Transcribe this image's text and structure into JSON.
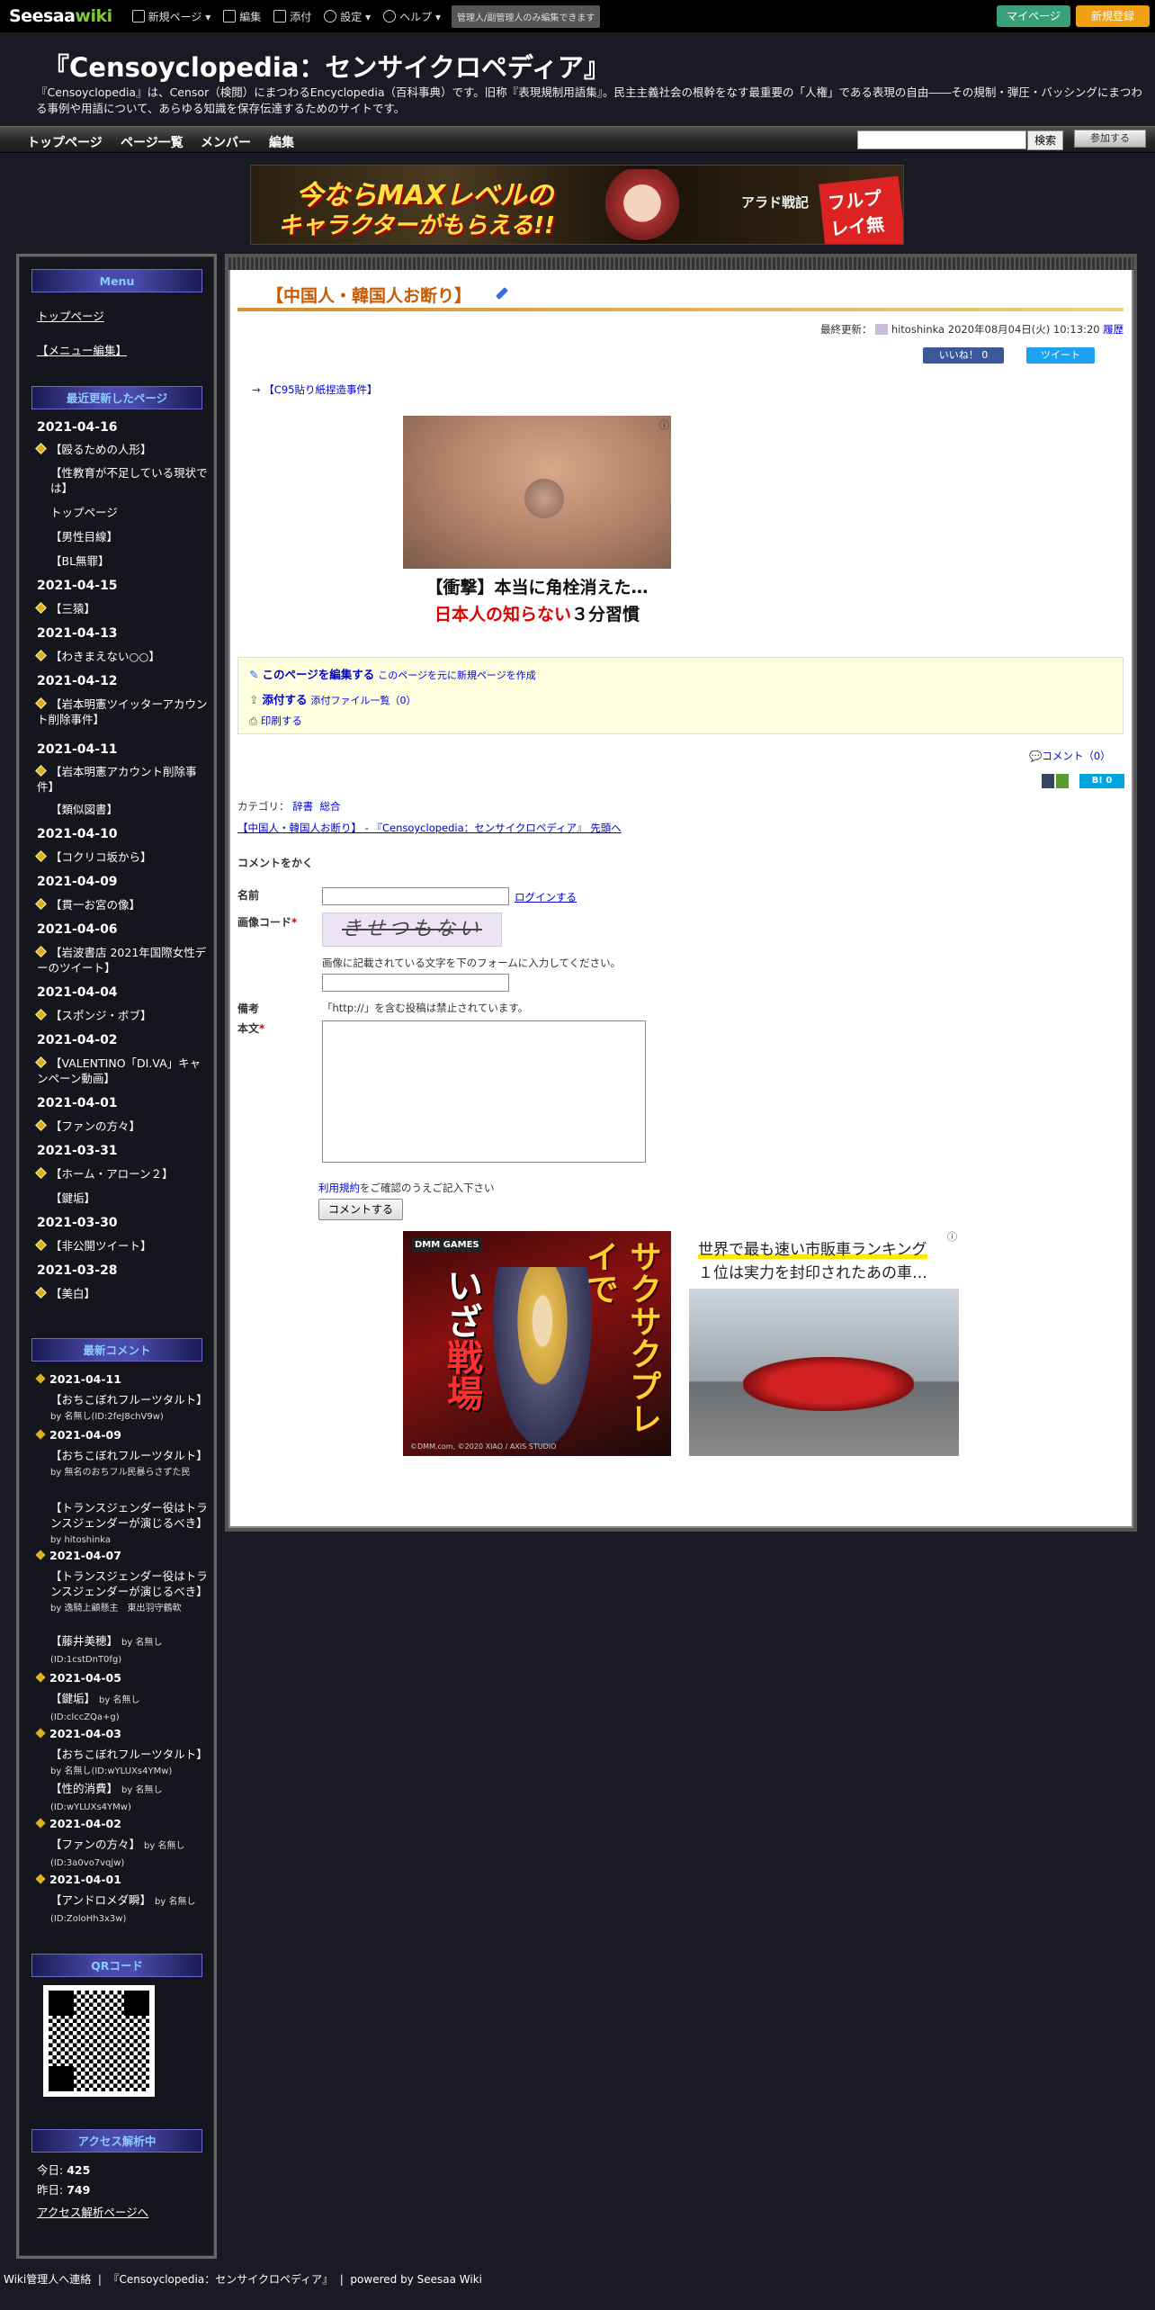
{
  "topbar": {
    "logo_a": "Seesaa",
    "logo_b": "wiki",
    "menu": [
      {
        "icon": "new-page-icon",
        "label": "新規ページ ▾"
      },
      {
        "icon": "edit-icon",
        "label": "編集"
      },
      {
        "icon": "image-icon",
        "label": "添付"
      },
      {
        "icon": "gear-icon",
        "label": "設定 ▾"
      },
      {
        "icon": "help-icon",
        "label": "ヘルプ ▾"
      }
    ],
    "notice": "管理人/副管理人のみ編集できます",
    "mypage": "マイページ",
    "register": "新規登録"
  },
  "header": {
    "title": "『Censoyclopedia：センサイクロペディア』",
    "description": "『Censoyclopedia』は、Censor（検閲）にまつわるEncyclopedia（百科事典）です。旧称『表現規制用語集』。民主主義社会の根幹をなす最重要の「人権」である表現の自由――その規制・弾圧・バッシングにまつわる事例や用語について、あらゆる知識を保存伝達するためのサイトです。"
  },
  "nav": {
    "items": [
      "トップページ",
      "ページ一覧",
      "メンバー",
      "編集"
    ],
    "search_button": "検索",
    "join_button": "参加する"
  },
  "banner": {
    "line1": "今ならMAXレベルの",
    "line2": "キャラクターがもらえる!!",
    "game": "アラド戦記",
    "badge": "フルプレイ無料!"
  },
  "sidebar": {
    "menu_head": "Menu",
    "menu_links": [
      "トップページ",
      "【メニュー編集】"
    ],
    "recent_head": "最近更新したページ",
    "recent": [
      {
        "date": "2021-04-16",
        "items": [
          "【殴るための人形】",
          "【性教育が不足している現状では】",
          "トップページ",
          "【男性目線】",
          "【BL無罪】"
        ]
      },
      {
        "date": "2021-04-15",
        "items": [
          "【三猿】"
        ]
      },
      {
        "date": "2021-04-13",
        "items": [
          "【わきまえない○○】"
        ]
      },
      {
        "date": "2021-04-12",
        "items": [
          "【岩本明憲ツイッターアカウント削除事件】"
        ]
      },
      {
        "date": "2021-04-11",
        "items": [
          "【岩本明憲アカウント削除事件】",
          "【類似図書】"
        ]
      },
      {
        "date": "2021-04-10",
        "items": [
          "【コクリコ坂から】"
        ]
      },
      {
        "date": "2021-04-09",
        "items": [
          "【貫一お宮の像】"
        ]
      },
      {
        "date": "2021-04-06",
        "items": [
          "【岩波書店 2021年国際女性デーのツイート】"
        ]
      },
      {
        "date": "2021-04-04",
        "items": [
          "【スポンジ・ボブ】"
        ]
      },
      {
        "date": "2021-04-02",
        "items": [
          "【VALENTINO「DI.VA」キャンペーン動画】"
        ]
      },
      {
        "date": "2021-04-01",
        "items": [
          "【ファンの方々】"
        ]
      },
      {
        "date": "2021-03-31",
        "items": [
          "【ホーム・アローン２】",
          "【鍵垢】"
        ]
      },
      {
        "date": "2021-03-30",
        "items": [
          "【非公開ツイート】"
        ]
      },
      {
        "date": "2021-03-28",
        "items": [
          "【美白】"
        ]
      }
    ],
    "comments_head": "最新コメント",
    "comments": [
      {
        "date": "2021-04-11",
        "items": [
          {
            "link": "【おちこぼれフルーツタルト】",
            "by": "by 名無し(ID:2feJ8chV9w)"
          }
        ]
      },
      {
        "date": "2021-04-09",
        "items": [
          {
            "link": "【おちこぼれフルーツタルト】",
            "by": "by 無名のおちフル民暴らさずた民"
          },
          {
            "link": "【トランスジェンダー役はトランスジェンダーが演じるべき】",
            "by": "by hitoshinka"
          }
        ]
      },
      {
        "date": "2021-04-07",
        "items": [
          {
            "link": "【トランスジェンダー役はトランスジェンダーが演じるべき】",
            "by": "by 逸騎上顧懸主　東出羽守鶴軟"
          },
          {
            "link": "【藤井美穂】",
            "by": "by 名無し(ID:1cstDnT0fg)"
          }
        ]
      },
      {
        "date": "2021-04-05",
        "items": [
          {
            "link": "【鍵垢】",
            "by": "by 名無し(ID:clccZQa+g)"
          }
        ]
      },
      {
        "date": "2021-04-03",
        "items": [
          {
            "link": "【おちこぼれフルーツタルト】",
            "by": "by 名無し(ID:wYLUXs4YMw)"
          },
          {
            "link": "【性的消費】",
            "by": "by 名無し(ID:wYLUXs4YMw)"
          }
        ]
      },
      {
        "date": "2021-04-02",
        "items": [
          {
            "link": "【ファンの方々】",
            "by": "by 名無し(ID:3a0vo7vqjw)"
          }
        ]
      },
      {
        "date": "2021-04-01",
        "items": [
          {
            "link": "【アンドロメダ瞬】",
            "by": "by 名無し(ID:ZoloHh3x3w)"
          }
        ]
      }
    ],
    "qr_head": "QRコード",
    "access_head": "アクセス解析中",
    "today_label": "今日:",
    "today_value": "425",
    "yesterday_label": "昨日:",
    "yesterday_value": "749",
    "access_link": "アクセス解析ページへ"
  },
  "main": {
    "title": "【中国人・韓国人お断り】",
    "last_updated_label": "最終更新：",
    "last_updated_user": "hitoshinka",
    "last_updated_date": "2020年08月04日(火) 10:13:20",
    "history": "履歴",
    "like": "いいね！ 0",
    "tweet": "ツイート",
    "arrow_link": "【C95貼り紙捏造事件】",
    "ad1_line1": "【衝撃】本当に角栓消えた…",
    "ad1_line2a": "日本人の知らない",
    "ad1_line2b": "３分習慣",
    "edit_page": "このページを編集する",
    "new_page_based": "このページを元に新規ページを作成",
    "attach": "添付する",
    "attach_list": "添付ファイル一覧（0）",
    "print": "印刷する",
    "comment_count": "コメント（0）",
    "hatena": "B! 0",
    "category_label": "カテゴリ：",
    "categories": [
      "辞書",
      "総合"
    ],
    "breadcrumb": "【中国人・韓国人お断り】 - 『Censoyclopedia：センサイクロペディア』 先頭へ",
    "comment_heading": "コメントをかく",
    "name_label": "名前",
    "login_link": "ログインする",
    "captcha_label": "画像コード",
    "captcha_text": "きせつもない",
    "captcha_hint": "画像に記載されている文字を下のフォームに入力してください。",
    "note_label": "備考",
    "note_text": "「http://」を含む投稿は禁止されています。",
    "body_label": "本文",
    "terms_link": "利用規約",
    "terms_text": "をご確認のうえご記入下さい",
    "submit": "コメントする",
    "ad2_brand": "DMM GAMES",
    "ad2_text1": "サクサクプレイで",
    "ad2_text2a": "いざ",
    "ad2_text2b": "戦場",
    "ad2_copy": "©DMM.com, ©2020 XIAO / AXIS STUDIO",
    "ad3_line1": "世界で最も速い市販車ランキング",
    "ad3_line2": "１位は実力を封印されたあの車…"
  },
  "footer": {
    "contact": "Wiki管理人へ連絡",
    "site": "『Censoyclopedia：センサイクロペディア』",
    "powered": "powered by",
    "seesaa": "Seesaa Wiki"
  }
}
